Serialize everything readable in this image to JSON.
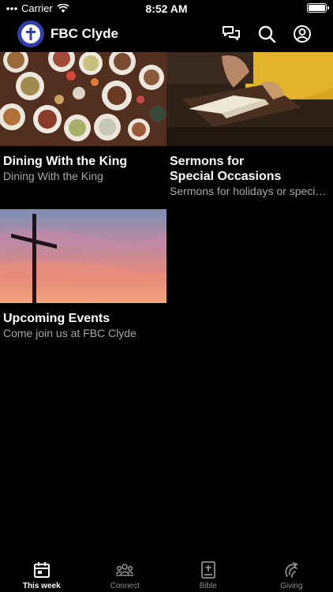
{
  "status_bar": {
    "carrier": "Carrier",
    "time": "8:52 AM"
  },
  "header": {
    "title": "FBC Clyde"
  },
  "cards": [
    {
      "title": "Dining With the King",
      "subtitle": "Dining With the King"
    },
    {
      "title": "Sermons for\nSpecial Occasions",
      "subtitle": "Sermons for holidays or special occasions"
    },
    {
      "title": "Upcoming Events",
      "subtitle": "Come join us at FBC Clyde"
    }
  ],
  "tabs": [
    {
      "label": "This week",
      "icon": "calendar-icon",
      "active": true
    },
    {
      "label": "Connect",
      "icon": "people-icon",
      "active": false
    },
    {
      "label": "Bible",
      "icon": "bible-icon",
      "active": false
    },
    {
      "label": "Giving",
      "icon": "giving-icon",
      "active": false
    }
  ],
  "colors": {
    "brand": "#2f3ea8",
    "background": "#000000",
    "subtitle": "#a7a7a7"
  }
}
